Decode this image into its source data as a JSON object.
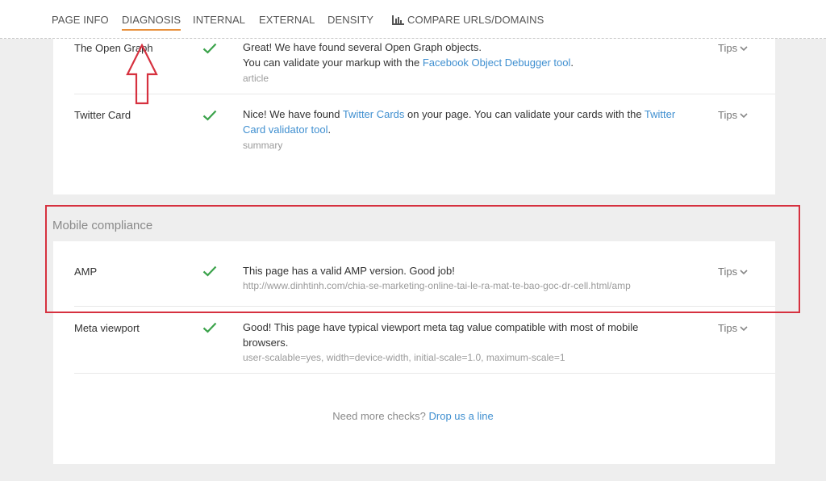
{
  "nav": {
    "tabs": [
      "PAGE INFO",
      "DIAGNOSIS",
      "INTERNAL",
      "EXTERNAL",
      "DENSITY",
      "COMPARE URLS/DOMAINS"
    ],
    "active": "DIAGNOSIS"
  },
  "rows": {
    "open_graph": {
      "label": "The Open Graph",
      "msg_line1": "Great! We have found several Open Graph objects.",
      "msg_line2_pre": "You can validate your markup with the ",
      "msg_line2_link": "Facebook Object Debugger tool",
      "msg_line2_post": ".",
      "value": "article",
      "tips": "Tips"
    },
    "twitter": {
      "label": "Twitter Card",
      "msg_pre": "Nice! We have found ",
      "msg_link1": "Twitter Cards",
      "msg_mid": " on your page. You can validate your cards with the ",
      "msg_link2": "Twitter Card validator tool",
      "msg_post": ".",
      "value": "summary",
      "tips": "Tips"
    },
    "amp": {
      "label": "AMP",
      "msg": "This page has a valid AMP version. Good job!",
      "value": "http://www.dinhtinh.com/chia-se-marketing-online-tai-le-ra-mat-te-bao-goc-dr-cell.html/amp",
      "tips": "Tips"
    },
    "viewport": {
      "label": "Meta viewport",
      "msg": "Good! This page have typical viewport meta tag value compatible with most of mobile browsers.",
      "value": "user-scalable=yes, width=device-width, initial-scale=1.0, maximum-scale=1",
      "tips": "Tips"
    }
  },
  "section_title": "Mobile compliance",
  "footer": {
    "text": "Need more checks? ",
    "link": "Drop us a line"
  },
  "colors": {
    "accent_underline": "#e8903a",
    "check_green": "#3aa24a",
    "link_blue": "#3f8fd0",
    "annotation_red": "#d6313f"
  }
}
